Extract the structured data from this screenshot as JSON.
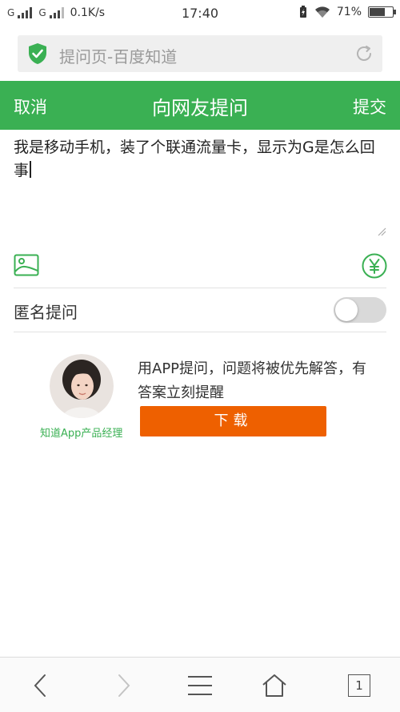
{
  "status_bar": {
    "sim1_label": "G",
    "sim2_label": "G",
    "network_speed": "0.1K/s",
    "time": "17:40",
    "battery_percent": "71%",
    "battery_level": 0.71
  },
  "url_bar": {
    "page_title": "提问页-百度知道"
  },
  "header": {
    "cancel_label": "取消",
    "title": "向网友提问",
    "submit_label": "提交"
  },
  "question": {
    "text": "我是移动手机，装了个联通流量卡，显示为G是怎么回事"
  },
  "anonymous": {
    "label": "匿名提问",
    "enabled": false
  },
  "promo": {
    "avatar_caption": "知道App产品经理",
    "text": "用APP提问，问题将被优先解答，有答案立刻提醒",
    "download_label": "下载"
  },
  "bottom_nav": {
    "tab_count": "1"
  },
  "colors": {
    "brand_green": "#3ab053",
    "download_orange": "#ee6000"
  }
}
